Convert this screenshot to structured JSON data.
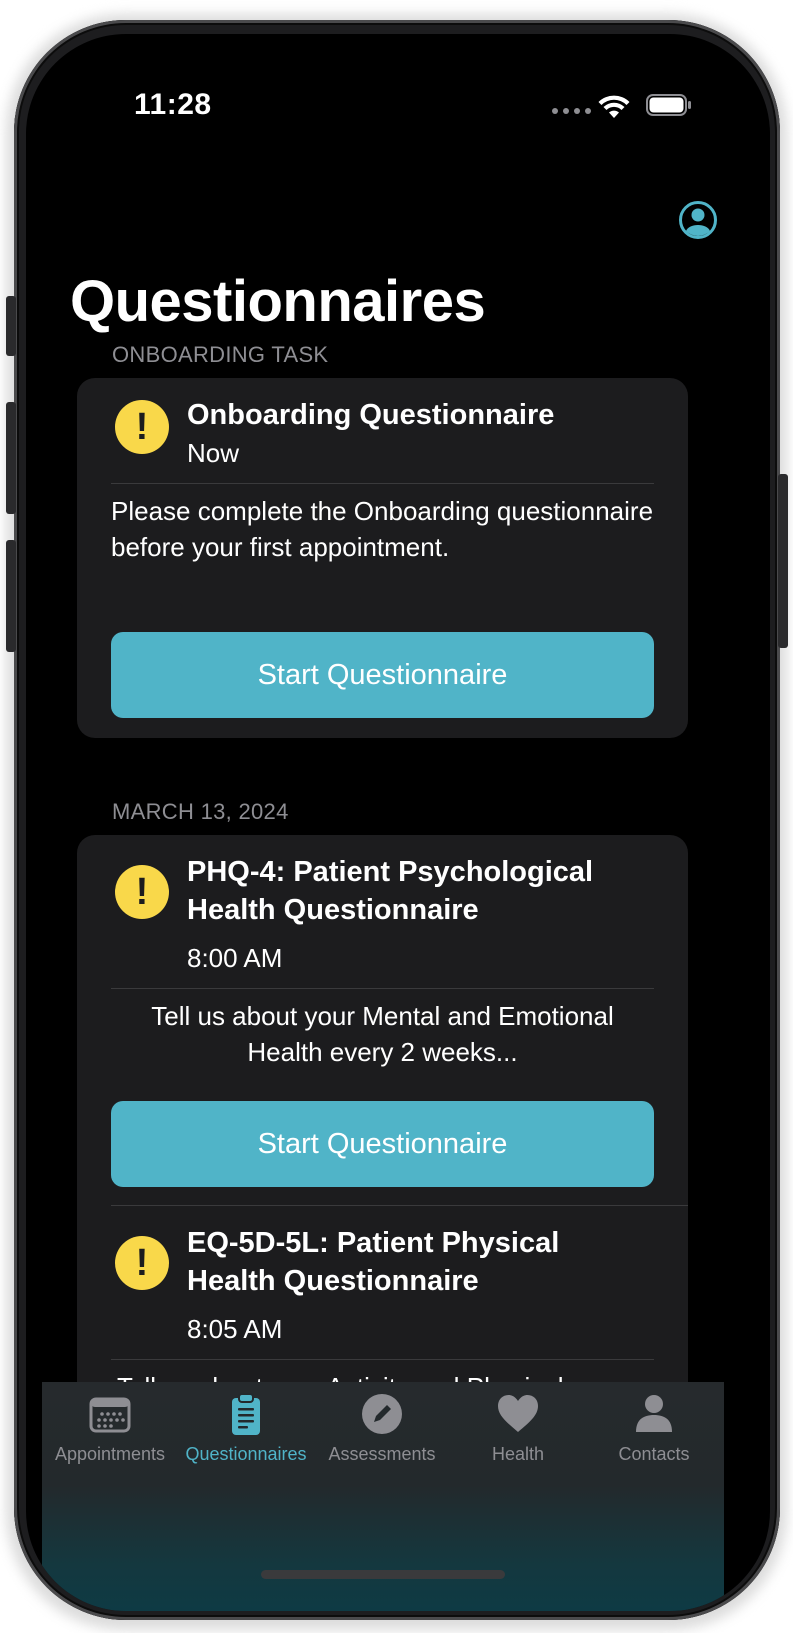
{
  "status_bar": {
    "time": "11:28"
  },
  "header": {
    "title": "Questionnaires",
    "profile_icon": "person-circle-icon"
  },
  "sections": [
    {
      "header": "ONBOARDING TASK",
      "items": [
        {
          "title": "Onboarding Questionnaire",
          "time": "Now",
          "description": "Please complete the Onboarding questionnaire before your first appointment.",
          "button": "Start Questionnaire"
        }
      ]
    },
    {
      "header": "MARCH 13, 2024",
      "items": [
        {
          "title": "PHQ-4: Patient Psychological Health Questionnaire",
          "time": "8:00 AM",
          "description": "Tell us about your Mental and Emotional Health every 2 weeks...",
          "button": "Start Questionnaire"
        },
        {
          "title": "EQ-5D-5L: Patient Physical Health Questionnaire",
          "time": "8:05 AM",
          "description": "Tell us about your Activity and Physical"
        }
      ]
    }
  ],
  "tabbar": {
    "tabs": [
      {
        "label": "Appointments",
        "icon": "calendar-icon"
      },
      {
        "label": "Questionnaires",
        "icon": "clipboard-icon",
        "active": true
      },
      {
        "label": "Assessments",
        "icon": "pencil-circle-icon"
      },
      {
        "label": "Health",
        "icon": "heart-icon"
      },
      {
        "label": "Contacts",
        "icon": "person-icon"
      }
    ]
  },
  "colors": {
    "accent": "#50b4c8",
    "alert": "#f9d84a",
    "card_bg": "#1c1c1e",
    "secondary_text": "#8e8e93"
  }
}
